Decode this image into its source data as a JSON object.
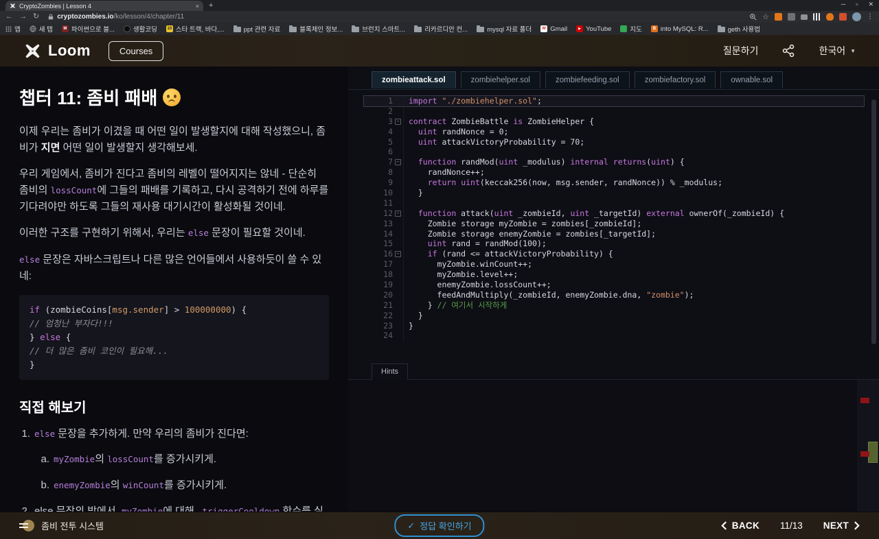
{
  "browser": {
    "tab_title": "CryptoZombies | Lesson 4",
    "tab_close": "×",
    "new_tab": "+",
    "window_controls": {
      "minimize": "─",
      "maximize": "▫",
      "close": "✕"
    },
    "nav": {
      "back": "←",
      "forward": "→",
      "reload": "↻"
    },
    "url_domain": "cryptozombies.io",
    "url_path": "/ko/lesson/4/chapter/11",
    "star": "☆",
    "menu_dots": "⋮",
    "bookmarks": [
      "앱",
      "새 탭",
      "파이썬으로 블...",
      "생활코딩",
      "스타 트랙, 바다,...",
      "ppt 관련 자료",
      "블록체인 정보...",
      "브런치 스마트...",
      "리카르디안 컨...",
      "mysql 자료 폴더",
      "Gmail",
      "YouTube",
      "지도",
      "into MySQL: R...",
      "geth 사용법"
    ],
    "bookmark_badges": {
      "m": "M",
      "ten": "10",
      "gmail": "M",
      "youtube": "▶",
      "b": "B"
    }
  },
  "header": {
    "brand": "Loom",
    "courses": "Courses",
    "ask": "질문하기",
    "lang": "한국어",
    "lang_caret": "▼"
  },
  "lesson": {
    "title": "챕터 11: 좀비 패배",
    "title_emoji": "😞",
    "p1": [
      "이제 우리는 좀비가 이겼을 때 어떤 일이 발생할지에 대해 작성했으니, 좀비가 ",
      "지면",
      " 어떤 일이 발생할지 생각해보세."
    ],
    "p2": [
      "우리 게임에서, 좀비가 진다고 좀비의 레벨이 떨어지지는 않네 - 단순히 좀비의 ",
      "lossCount",
      "에 그들의 패배를 기록하고, 다시 공격하기 전에 하루를 기다려야만 하도록 그들의 재사용 대기시간이 활성화될 것이네."
    ],
    "p3": [
      "이러한 구조를 구현하기 위해서, 우리는 ",
      "else",
      " 문장이 필요할 것이네."
    ],
    "p4": [
      "else",
      " 문장은 자바스크립트나 다른 많은 언어들에서 사용하듯이 쓸 수 있네:"
    ],
    "code_lines": [
      [
        [
          "k",
          "if"
        ],
        [
          "p",
          " (zombieCoins["
        ],
        [
          "o",
          "msg.sender"
        ],
        [
          "p",
          "] > "
        ],
        [
          "o",
          "100000000"
        ],
        [
          "p",
          ") {"
        ]
      ],
      [
        [
          "c",
          "  // 엄청난 부자다!!!"
        ]
      ],
      [
        [
          "p",
          "} "
        ],
        [
          "k",
          "else"
        ],
        [
          "p",
          " {"
        ]
      ],
      [
        [
          "c",
          "  // 더 많은 좀비 코인이 필요해..."
        ]
      ],
      [
        [
          "p",
          "}"
        ]
      ]
    ],
    "try_title": "직접 해보기",
    "m1": "1.",
    "li1": [
      [
        "code",
        "else"
      ],
      [
        "t",
        " 문장을 추가하게. 만약 우리의 좀비가 진다면:"
      ]
    ],
    "ma": "a.",
    "li1a": [
      [
        "code",
        "myZombie"
      ],
      [
        "t",
        "의 "
      ],
      [
        "code",
        "lossCount"
      ],
      [
        "t",
        "를 증가시키게."
      ]
    ],
    "mb": "b.",
    "li1b": [
      [
        "code",
        "enemyZombie"
      ],
      [
        "t",
        "의 "
      ],
      [
        "code",
        "winCount"
      ],
      [
        "t",
        "를 증가시키게."
      ]
    ],
    "m2": "2.",
    "li2": [
      [
        "t",
        "else 문장의 밖에서, "
      ],
      [
        "code",
        "myZombie"
      ],
      [
        "t",
        "에 대해 "
      ],
      [
        "code",
        "_triggerCooldown"
      ],
      [
        "t",
        " 함수를 실행하게. 이러한 방법으로 해당 좀비는 하루에 한 번만 공격할 수 있네."
      ]
    ]
  },
  "editor": {
    "tabs": [
      "zombieattack.sol",
      "zombiehelper.sol",
      "zombiefeeding.sol",
      "zombiefactory.sol",
      "ownable.sol"
    ],
    "active_tab": "zombieattack.sol",
    "hints_label": "Hints",
    "fold_glyph": "−",
    "lines": [
      {
        "n": 1,
        "active": true,
        "seg": [
          [
            "k",
            "import"
          ],
          [
            "p",
            " "
          ],
          [
            "s",
            "\"./zombiehelper.sol\""
          ],
          [
            "p",
            ";"
          ]
        ]
      },
      {
        "n": 2,
        "seg": []
      },
      {
        "n": 3,
        "fold": true,
        "seg": [
          [
            "k",
            "contract"
          ],
          [
            "p",
            " ZombieBattle "
          ],
          [
            "k",
            "is"
          ],
          [
            "p",
            " ZombieHelper {"
          ]
        ]
      },
      {
        "n": 4,
        "seg": [
          [
            "p",
            "  "
          ],
          [
            "k",
            "uint"
          ],
          [
            "p",
            " randNonce = 0;"
          ]
        ]
      },
      {
        "n": 5,
        "seg": [
          [
            "p",
            "  "
          ],
          [
            "k",
            "uint"
          ],
          [
            "p",
            " attackVictoryProbability = 70;"
          ]
        ]
      },
      {
        "n": 6,
        "seg": []
      },
      {
        "n": 7,
        "fold": true,
        "seg": [
          [
            "p",
            "  "
          ],
          [
            "k",
            "function"
          ],
          [
            "p",
            " randMod("
          ],
          [
            "k",
            "uint"
          ],
          [
            "p",
            " _modulus) "
          ],
          [
            "k",
            "internal"
          ],
          [
            "p",
            " "
          ],
          [
            "k",
            "returns"
          ],
          [
            "p",
            "("
          ],
          [
            "k",
            "uint"
          ],
          [
            "p",
            ") {"
          ]
        ]
      },
      {
        "n": 8,
        "seg": [
          [
            "p",
            "    randNonce++;"
          ]
        ]
      },
      {
        "n": 9,
        "seg": [
          [
            "p",
            "    "
          ],
          [
            "k",
            "return"
          ],
          [
            "p",
            " "
          ],
          [
            "k",
            "uint"
          ],
          [
            "p",
            "(keccak256(now, msg.sender, randNonce)) % _modulus;"
          ]
        ]
      },
      {
        "n": 10,
        "seg": [
          [
            "p",
            "  }"
          ]
        ]
      },
      {
        "n": 11,
        "seg": []
      },
      {
        "n": 12,
        "fold": true,
        "seg": [
          [
            "p",
            "  "
          ],
          [
            "k",
            "function"
          ],
          [
            "p",
            " attack("
          ],
          [
            "k",
            "uint"
          ],
          [
            "p",
            " _zombieId, "
          ],
          [
            "k",
            "uint"
          ],
          [
            "p",
            " _targetId) "
          ],
          [
            "k",
            "external"
          ],
          [
            "p",
            " ownerOf(_zombieId) {"
          ]
        ]
      },
      {
        "n": 13,
        "seg": [
          [
            "p",
            "    Zombie storage myZombie = zombies[_zombieId];"
          ]
        ]
      },
      {
        "n": 14,
        "seg": [
          [
            "p",
            "    Zombie storage enemyZombie = zombies[_targetId];"
          ]
        ]
      },
      {
        "n": 15,
        "seg": [
          [
            "p",
            "    "
          ],
          [
            "k",
            "uint"
          ],
          [
            "p",
            " rand = randMod(100);"
          ]
        ]
      },
      {
        "n": 16,
        "fold": true,
        "seg": [
          [
            "p",
            "    "
          ],
          [
            "k",
            "if"
          ],
          [
            "p",
            " (rand <= attackVictoryProbability) {"
          ]
        ]
      },
      {
        "n": 17,
        "seg": [
          [
            "p",
            "      myZombie.winCount++;"
          ]
        ]
      },
      {
        "n": 18,
        "seg": [
          [
            "p",
            "      myZombie.level++;"
          ]
        ]
      },
      {
        "n": 19,
        "seg": [
          [
            "p",
            "      enemyZombie.lossCount++;"
          ]
        ]
      },
      {
        "n": 20,
        "seg": [
          [
            "p",
            "      feedAndMultiply(_zombieId, enemyZombie.dna, "
          ],
          [
            "s",
            "\"zombie\""
          ],
          [
            "p",
            ");"
          ]
        ]
      },
      {
        "n": 21,
        "seg": [
          [
            "p",
            "    } "
          ],
          [
            "g",
            "// 여기서 시작하게"
          ]
        ]
      },
      {
        "n": 22,
        "seg": [
          [
            "p",
            "  }"
          ]
        ]
      },
      {
        "n": 23,
        "seg": [
          [
            "p",
            "}"
          ]
        ]
      },
      {
        "n": 24,
        "seg": []
      }
    ]
  },
  "footer": {
    "lesson_name": "좀비 전투 시스템",
    "check_label": "정답 확인하기",
    "check_mark": "✓",
    "back": "BACK",
    "page": "11/13",
    "next": "NEXT"
  },
  "colors": {
    "accent_blue": "#2f8fd4",
    "keyword_blue": "#5f9fd0",
    "string_orange": "#d2916a",
    "comment_green": "#55a049",
    "inline_code_purple": "#b67fd8",
    "annotation_red": "#8f1418",
    "annotation_green": "#55632f"
  }
}
